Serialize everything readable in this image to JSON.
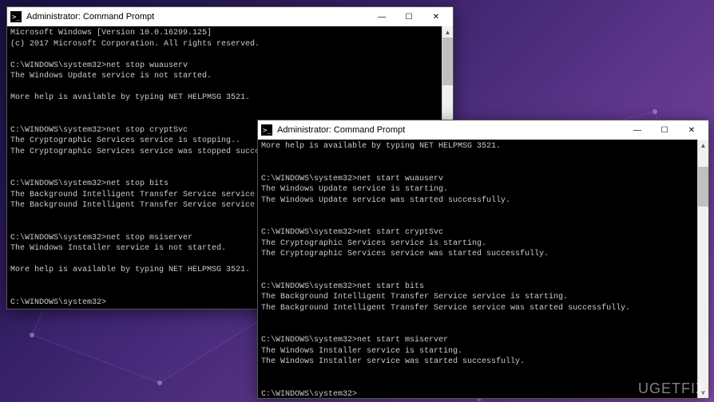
{
  "window1": {
    "title": "Administrator: Command Prompt",
    "lines": [
      "Microsoft Windows [Version 10.0.16299.125]",
      "(c) 2017 Microsoft Corporation. All rights reserved.",
      "",
      "C:\\WINDOWS\\system32>net stop wuauserv",
      "The Windows Update service is not started.",
      "",
      "More help is available by typing NET HELPMSG 3521.",
      "",
      "",
      "C:\\WINDOWS\\system32>net stop cryptSvc",
      "The Cryptographic Services service is stopping..",
      "The Cryptographic Services service was stopped successfully.",
      "",
      "",
      "C:\\WINDOWS\\system32>net stop bits",
      "The Background Intelligent Transfer Service service is stopping..",
      "The Background Intelligent Transfer Service service was stopped successfully.",
      "",
      "",
      "C:\\WINDOWS\\system32>net stop msiserver",
      "The Windows Installer service is not started.",
      "",
      "More help is available by typing NET HELPMSG 3521.",
      "",
      "",
      "C:\\WINDOWS\\system32>"
    ]
  },
  "window2": {
    "title": "Administrator: Command Prompt",
    "lines": [
      "More help is available by typing NET HELPMSG 3521.",
      "",
      "",
      "C:\\WINDOWS\\system32>net start wuauserv",
      "The Windows Update service is starting.",
      "The Windows Update service was started successfully.",
      "",
      "",
      "C:\\WINDOWS\\system32>net start cryptSvc",
      "The Cryptographic Services service is starting.",
      "The Cryptographic Services service was started successfully.",
      "",
      "",
      "C:\\WINDOWS\\system32>net start bits",
      "The Background Intelligent Transfer Service service is starting.",
      "The Background Intelligent Transfer Service service was started successfully.",
      "",
      "",
      "C:\\WINDOWS\\system32>net start msiserver",
      "The Windows Installer service is starting.",
      "The Windows Installer service was started successfully.",
      "",
      "",
      "C:\\WINDOWS\\system32>"
    ]
  },
  "controls": {
    "minimize": "—",
    "maximize": "☐",
    "close": "✕"
  },
  "watermark": "UGETFIX"
}
